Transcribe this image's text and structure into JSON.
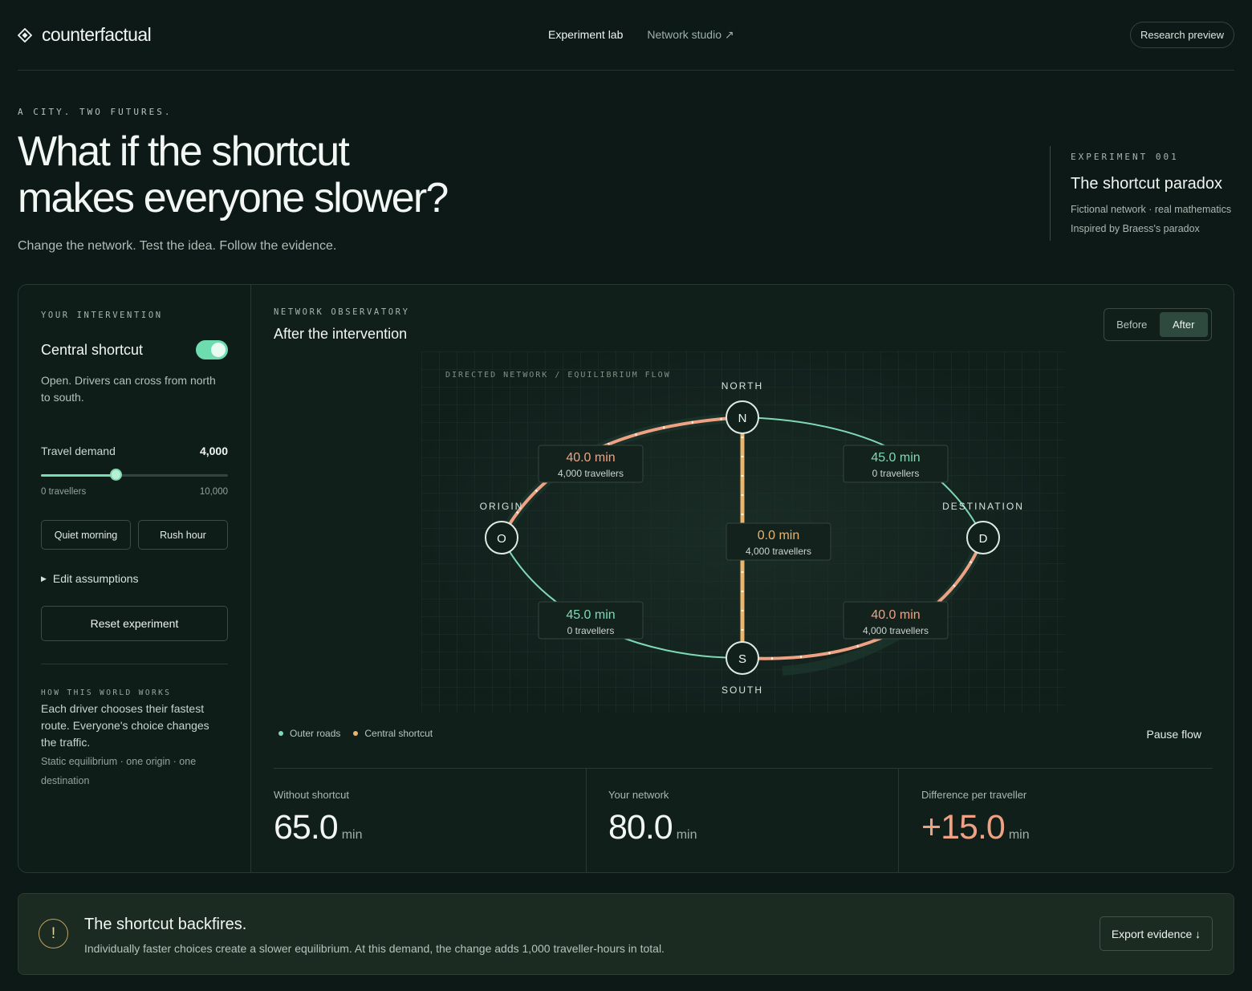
{
  "brand": {
    "name": "counterfactual",
    "logo_icon": "diamond-icon"
  },
  "nav": {
    "items": [
      "Experiment lab",
      "Network studio ↗"
    ],
    "active": "Experiment lab"
  },
  "header": {
    "research_label": "Research preview"
  },
  "hero": {
    "kicker": "A CITY. TWO FUTURES.",
    "title_line1": "What if the shortcut",
    "title_line2": "makes everyone slower?",
    "subtitle": "Change the network. Test the idea. Follow the evidence."
  },
  "experiment": {
    "kicker": "EXPERIMENT 001",
    "title": "The shortcut paradox",
    "line1": "Fictional network · real mathematics",
    "line2": "Inspired by Braess's paradox"
  },
  "sidebar": {
    "kicker": "YOUR INTERVENTION",
    "toggle_label": "Central shortcut",
    "toggle_on": true,
    "description": "Open. Drivers can cross from north to south.",
    "demand_label": "Travel demand",
    "demand_value": "4,000",
    "demand_fraction": 0.4,
    "range_min": "0 travellers",
    "range_max": "10,000",
    "presets": [
      "Quiet morning",
      "Rush hour"
    ],
    "edit_label": "Edit assumptions",
    "reset_label": "Reset experiment",
    "how_kicker": "HOW THIS WORLD WORKS",
    "how_text": "Each driver chooses their fastest route. Everyone's choice changes the traffic.",
    "how_meta": "Static equilibrium · one origin · one destination"
  },
  "observatory": {
    "kicker": "NETWORK OBSERVATORY",
    "title": "After the intervention",
    "toggle": {
      "before": "Before",
      "after": "After",
      "selected": "After"
    },
    "graph_caption": "DIRECTED NETWORK / EQUILIBRIUM FLOW",
    "nodes": {
      "north": {
        "letter": "N",
        "label": "NORTH"
      },
      "south": {
        "letter": "S",
        "label": "SOUTH"
      },
      "origin": {
        "letter": "O",
        "label": "ORIGIN"
      },
      "destination": {
        "letter": "D",
        "label": "DESTINATION"
      }
    },
    "edges": {
      "origin_north": {
        "time": "40.0 min",
        "travellers": "4,000 travellers"
      },
      "north_destination": {
        "time": "45.0 min",
        "travellers": "0 travellers"
      },
      "north_south": {
        "time": "0.0 min",
        "travellers": "4,000 travellers"
      },
      "origin_south": {
        "time": "45.0 min",
        "travellers": "0 travellers"
      },
      "south_destination": {
        "time": "40.0 min",
        "travellers": "4,000 travellers"
      }
    },
    "legend": [
      "Outer roads",
      "Central shortcut"
    ],
    "pause_label": "Pause flow"
  },
  "stats": {
    "without": {
      "label": "Without shortcut",
      "value": "65.0",
      "unit": "min"
    },
    "yours": {
      "label": "Your network",
      "value": "80.0",
      "unit": "min"
    },
    "diff": {
      "label": "Difference per traveller",
      "value": "+15.0",
      "unit": "min"
    }
  },
  "alert": {
    "icon": "exclamation-icon",
    "title": "The shortcut backfires.",
    "body": "Individually faster choices create a slower equilibrium. At this demand, the change adds 1,000 traveller-hours in total.",
    "export_label": "Export evidence ↓"
  },
  "colors": {
    "background": "#0c1916",
    "outer_road": "#7fd9b5",
    "loaded_road": "#eea283",
    "shortcut": "#e9b56f",
    "alert_accent": "#bda365"
  }
}
